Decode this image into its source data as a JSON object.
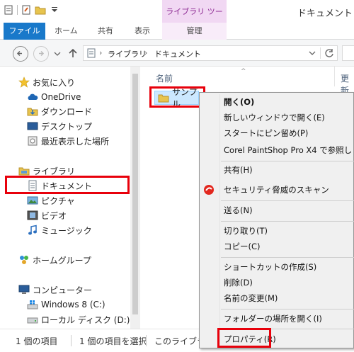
{
  "window": {
    "title": "ドキュメント",
    "contextual_tab_group": "ライブラリ ツール"
  },
  "ribbon": {
    "tabs": [
      "ファイル",
      "ホーム",
      "共有",
      "表示"
    ],
    "contextual_tab": "管理"
  },
  "address_bar": {
    "segments": [
      "ライブラリ",
      "ドキュメント"
    ]
  },
  "nav_pane": {
    "favorites_label": "お気に入り",
    "favorites": [
      "OneDrive",
      "ダウンロード",
      "デスクトップ",
      "最近表示した場所"
    ],
    "libraries_label": "ライブラリ",
    "libraries": [
      "ドキュメント",
      "ピクチャ",
      "ビデオ",
      "ミュージック"
    ],
    "homegroup_label": "ホームグループ",
    "computer_label": "コンピューター",
    "drives": [
      "Windows 8 (C:)",
      "ローカル ディスク (D:)"
    ]
  },
  "file_list": {
    "columns": [
      "名前",
      "更新"
    ],
    "items": [
      "サンプル"
    ]
  },
  "status_bar": {
    "item_count": "1 個の項目",
    "selected": "1 個の項目を選択",
    "library_info": "このライブラリ"
  },
  "context_menu": {
    "groups": [
      [
        "開く(O)",
        "新しいウィンドウで開く(E)",
        "スタートにピン留め(P)",
        "Corel PaintShop Pro X4 で参照し"
      ],
      [
        "共有(H)",
        "セキュリティ脅威のスキャン"
      ],
      [
        "送る(N)"
      ],
      [
        "切り取り(T)",
        "コピー(C)"
      ],
      [
        "ショートカットの作成(S)",
        "削除(D)",
        "名前の変更(M)"
      ],
      [
        "フォルダーの場所を開く(I)"
      ],
      [
        "プロパティ(R)"
      ]
    ]
  },
  "colors": {
    "accent": "#1979ca",
    "highlight": "#e8000b",
    "contextual": "#8d2a93"
  }
}
